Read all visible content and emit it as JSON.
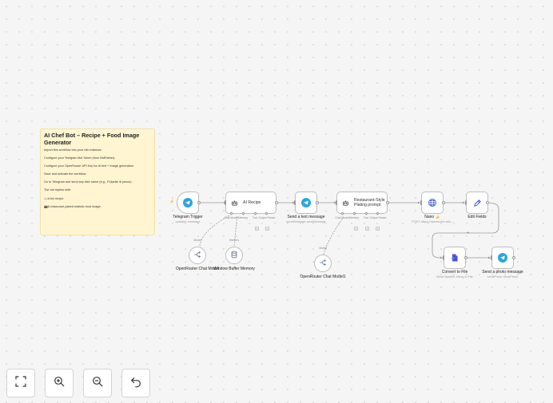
{
  "sticky": {
    "title": "AI Chef Bot – Recipe + Food Image Generator",
    "lines": [
      "Import this workflow into your n8n instance.",
      "Configure your Telegram Bot Token (from BotFather).",
      "Configure your OpenRouter API Key for AI text + image generation.",
      "Save and activate the workflow.",
      "Go to Telegram and send any dish name (e.g., Polpette di pesce).",
      "The bot replies with:",
      "📖A full recipe.",
      "📸A restaurant-plated realistic food image."
    ]
  },
  "nodes": {
    "telegram_trigger": {
      "label": "Telegram Trigger",
      "sub": "updates: message",
      "icon": "telegram-icon"
    },
    "ai_recipe": {
      "title": "AI Recipe",
      "icon": "robot-icon",
      "ports": [
        "Chat Model",
        "Memory",
        "Tool",
        "Output Parser"
      ]
    },
    "send_text": {
      "label": "Send a text message",
      "sub": "sendMessage: sendMessage",
      "icon": "telegram-icon"
    },
    "plating_prompt": {
      "title": "Restaurant-Style Plating prompt",
      "icon": "robot-icon",
      "ports": [
        "Chat Model",
        "Memory",
        "Tool",
        "Output Parser"
      ]
    },
    "nano": {
      "label": "Nano 🍌",
      "sub": "POST: https://openrouter.ai/a...",
      "icon": "globe-icon"
    },
    "edit_fields": {
      "label": "Edit Fields",
      "icon": "pencil-icon"
    },
    "convert_file": {
      "label": "Convert to File",
      "sub": "Move Base64 String to File",
      "icon": "file-convert-icon"
    },
    "send_photo": {
      "label": "Send a photo message",
      "sub": "sendPhoto: sendPhoto",
      "icon": "telegram-icon"
    },
    "openrouter_1": {
      "label": "OpenRouter Chat Model",
      "icon": "openrouter-icon"
    },
    "window_memory": {
      "label": "Window Buffer Memory",
      "icon": "database-icon"
    },
    "openrouter_2": {
      "label": "OpenRouter Chat Model1",
      "icon": "openrouter-icon"
    }
  },
  "edge_labels": {
    "model": "Model",
    "memory": "Memory"
  },
  "controls": [
    {
      "name": "fit-view",
      "icon": "fit-view-icon"
    },
    {
      "name": "zoom-in",
      "icon": "zoom-in-icon"
    },
    {
      "name": "zoom-out",
      "icon": "zoom-out-icon"
    },
    {
      "name": "undo",
      "icon": "undo-icon"
    }
  ],
  "colors": {
    "telegram": "#2ca5e0",
    "accent": "#5a5ad6",
    "sticky": "#fff5d1",
    "node_border": "#bdbdbd"
  }
}
